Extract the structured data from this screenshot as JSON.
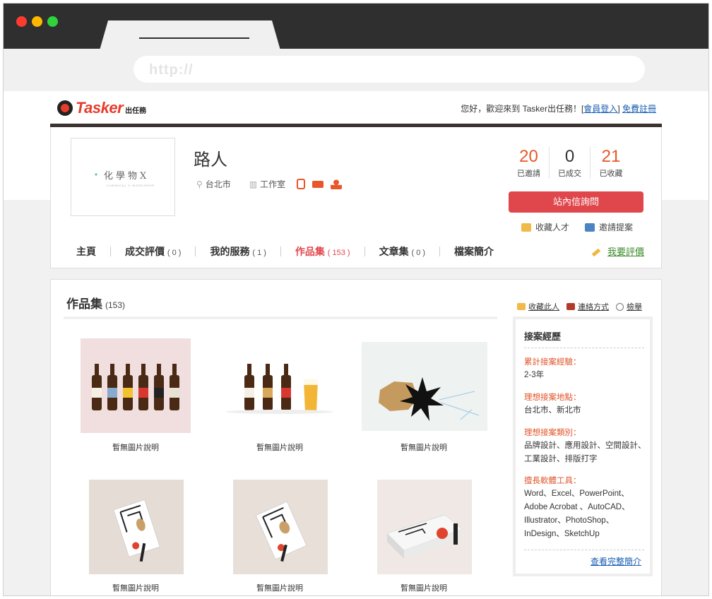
{
  "browser": {
    "address": "http://"
  },
  "header": {
    "logo_text": "Tasker",
    "logo_sub": "出任務",
    "greeting": "您好，歡迎來到 Tasker出任務！",
    "login_link": "會員登入",
    "register_link": "免費註冊"
  },
  "profile": {
    "avatar_text": "化學物X",
    "avatar_subtext": "CHEMICAL X WORKSHOP",
    "name": "路人",
    "location": "台北市",
    "type": "工作室",
    "stats": [
      {
        "value": "20",
        "label": "已邀請"
      },
      {
        "value": "0",
        "label": "已成交"
      },
      {
        "value": "21",
        "label": "已收藏"
      }
    ],
    "inquire_button": "站內信詢問",
    "collect_label": "收藏人才",
    "invite_label": "邀請提案",
    "rate_label": "我要評價"
  },
  "nav": {
    "items": [
      {
        "label": "主頁",
        "count": ""
      },
      {
        "label": "成交評價",
        "count": "( 0 )"
      },
      {
        "label": "我的服務",
        "count": "( 1 )"
      },
      {
        "label": "作品集",
        "count": "( 153 )"
      },
      {
        "label": "文章集",
        "count": "( 0 )"
      },
      {
        "label": "檔案簡介",
        "count": ""
      }
    ],
    "active_index": 3
  },
  "portfolio": {
    "title": "作品集",
    "count": "(153)",
    "items": [
      {
        "caption": "暫無圖片說明"
      },
      {
        "caption": "暫無圖片說明"
      },
      {
        "caption": "暫無圖片說明"
      },
      {
        "caption": "暫無圖片說明"
      },
      {
        "caption": "暫無圖片說明"
      },
      {
        "caption": "暫無圖片說明"
      }
    ]
  },
  "actions": {
    "collect": "收藏此人",
    "contact": "連絡方式",
    "report": "檢舉"
  },
  "experience": {
    "title": "接案經歷",
    "fields": [
      {
        "key": "累計接案經驗：",
        "value": "2-3年"
      },
      {
        "key": "理想接案地點：",
        "value": "台北市、新北市"
      },
      {
        "key": "理想接案類別：",
        "value": "品牌設計、應用設計、空間設計、工業設計、排版打字"
      },
      {
        "key": "擅長軟體工具：",
        "value": "Word、Excel、PowerPoint、Adobe Acrobat 、AutoCAD、Illustrator、PhotoShop、InDesign、SketchUp"
      }
    ],
    "more_link": "查看完整簡介"
  },
  "colors": {
    "accent_red": "#e0474c",
    "accent_orange": "#e8572a",
    "link_blue": "#1a5fb4"
  }
}
